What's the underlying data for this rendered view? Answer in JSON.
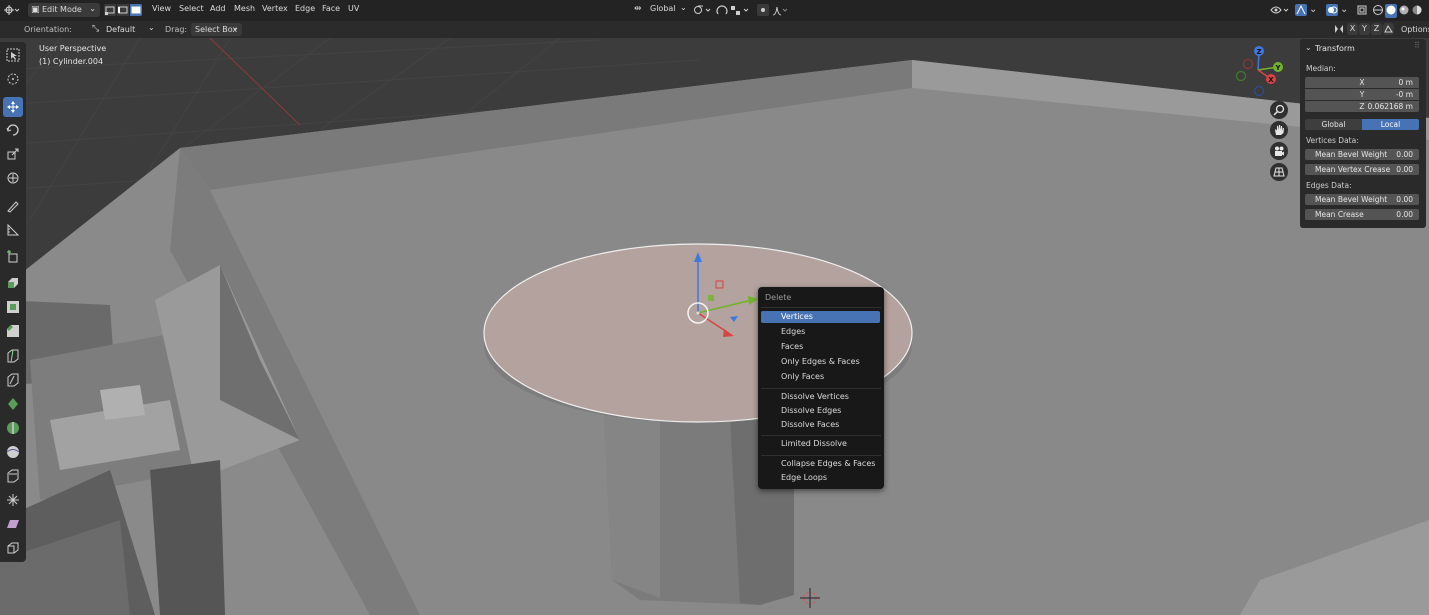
{
  "header": {
    "mode": "Edit Mode",
    "menus": [
      "View",
      "Select",
      "Add",
      "Mesh",
      "Vertex",
      "Edge",
      "Face",
      "UV"
    ],
    "transform_orientation": "Global",
    "options": "Options",
    "axis_x": "X",
    "axis_y": "Y",
    "axis_z": "Z"
  },
  "tool_settings": {
    "orientation_label": "Orientation:",
    "orientation_value": "Default",
    "drag_label": "Drag:",
    "drag_value": "Select Box"
  },
  "viewport": {
    "view_name": "User Perspective",
    "object_name": "(1) Cylinder.004"
  },
  "gizmo": {
    "x_label": "X",
    "y_label": "Y",
    "z_label": "Z"
  },
  "delete_menu": {
    "title": "Delete",
    "items": [
      "Vertices",
      "Edges",
      "Faces",
      "Only Edges & Faces",
      "Only Faces",
      "Dissolve Vertices",
      "Dissolve Edges",
      "Dissolve Faces",
      "Limited Dissolve",
      "Collapse Edges & Faces",
      "Edge Loops"
    ],
    "selected": "Vertices"
  },
  "transform_panel": {
    "title": "Transform",
    "median_label": "Median:",
    "x_label": "X",
    "x_value": "0 m",
    "y_label": "Y",
    "y_value": "-0 m",
    "z_label": "Z",
    "z_value": "0.062168 m",
    "global_tab": "Global",
    "local_tab": "Local",
    "vertices_data_label": "Vertices Data:",
    "mean_bevel_weight_v": "Mean Bevel Weight",
    "mean_bevel_weight_v_value": "0.00",
    "mean_vertex_crease": "Mean Vertex Crease",
    "mean_vertex_crease_value": "0.00",
    "edges_data_label": "Edges Data:",
    "mean_bevel_weight_e": "Mean Bevel Weight",
    "mean_bevel_weight_e_value": "0.00",
    "mean_crease": "Mean Crease",
    "mean_crease_value": "0.00"
  },
  "colors": {
    "accent": "#4772b3",
    "header_bg": "#232323",
    "menu_bg": "#181818",
    "face_selected": "#b5a39e"
  }
}
